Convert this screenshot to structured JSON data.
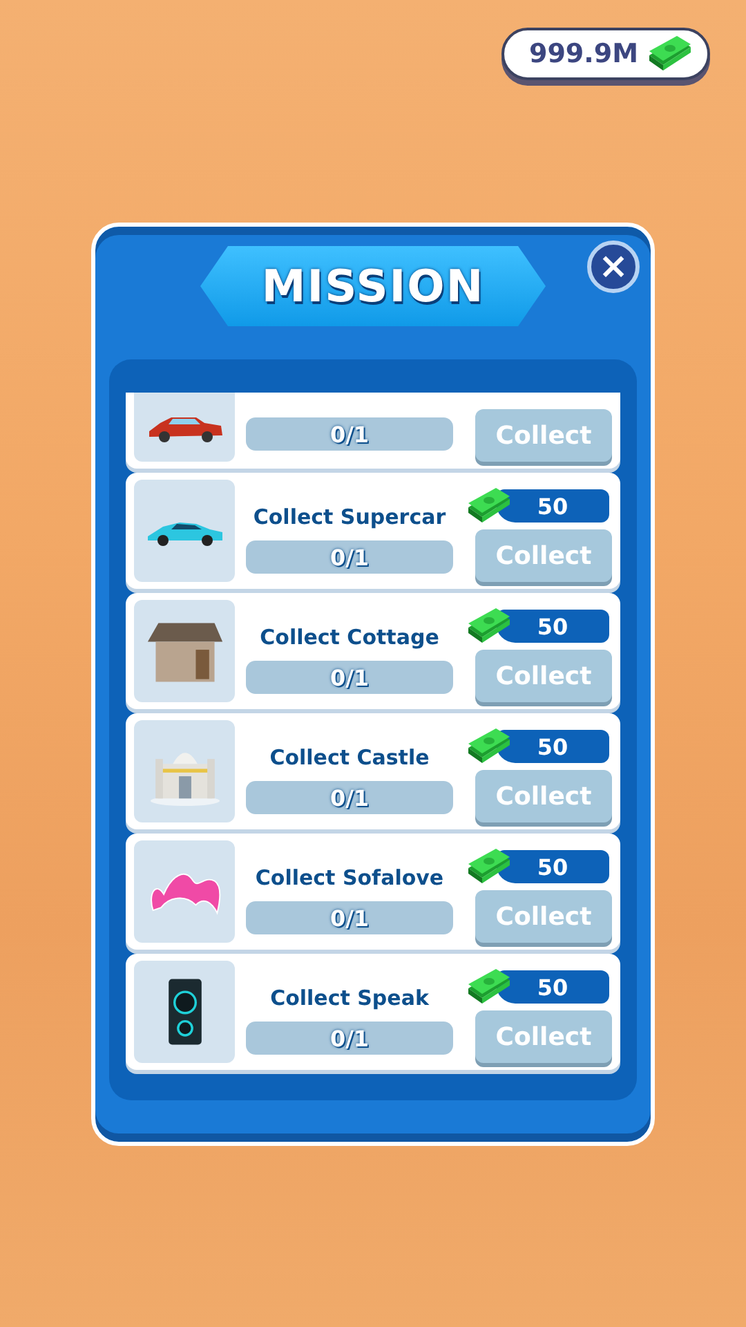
{
  "balance": {
    "amount": "999.9M"
  },
  "dialog": {
    "title": "MISSION",
    "close_label": "×"
  },
  "missions": [
    {
      "kind": "car",
      "partial": true,
      "progress": "0/1",
      "button": "Collect",
      "disabled": true
    },
    {
      "kind": "supercar",
      "partial": false,
      "title": "Collect Supercar",
      "reward": "50",
      "progress": "0/1",
      "button": "Collect",
      "disabled": true
    },
    {
      "kind": "cottage",
      "partial": false,
      "title": "Collect Cottage",
      "reward": "50",
      "progress": "0/1",
      "button": "Collect",
      "disabled": true
    },
    {
      "kind": "castle",
      "partial": false,
      "title": "Collect Castle",
      "reward": "50",
      "progress": "0/1",
      "button": "Collect",
      "disabled": true
    },
    {
      "kind": "sofa",
      "partial": false,
      "title": "Collect Sofalove",
      "reward": "50",
      "progress": "0/1",
      "button": "Collect",
      "disabled": true
    },
    {
      "kind": "speaker",
      "partial": false,
      "title": "Collect Speak",
      "reward": "50",
      "progress": "0/1",
      "button": "Collect",
      "disabled": true
    }
  ]
}
